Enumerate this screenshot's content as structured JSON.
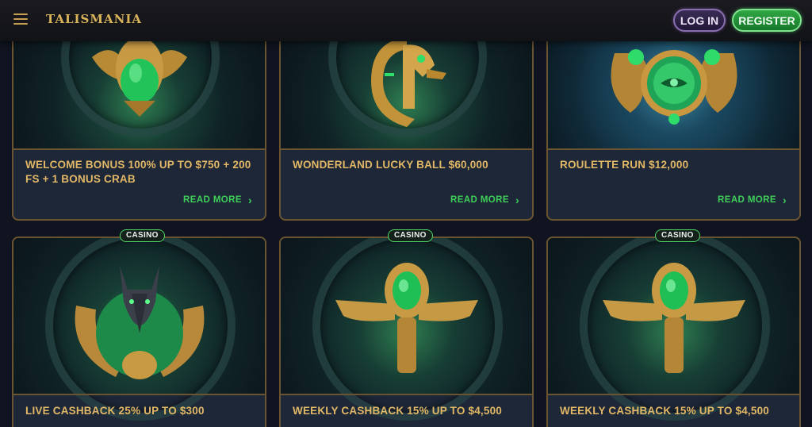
{
  "header": {
    "logo": "TALISMANIA",
    "login_label": "LOG IN",
    "register_label": "REGISTER"
  },
  "cards": [
    {
      "title": "WELCOME BONUS 100% UP TO $750 + 200 FS + 1 BONUS CRAB",
      "cta": "READ MORE"
    },
    {
      "title": "WONDERLAND LUCKY BALL $60,000",
      "cta": "READ MORE"
    },
    {
      "title": "ROULETTE RUN $12,000",
      "cta": "READ MORE"
    },
    {
      "title": "LIVE CASHBACK 25% UP TO $300",
      "badge": "CASINO"
    },
    {
      "title": "WEEKLY CASHBACK 15% UP TO $4,500",
      "badge": "CASINO"
    },
    {
      "title": "WEEKLY CASHBACK 15% UP TO $4,500",
      "badge": "CASINO"
    }
  ],
  "icons": {
    "menu": "hamburger-icon",
    "chevron": "chevron-right-icon"
  },
  "colors": {
    "accent_gold": "#e2b866",
    "read_more_green": "#3fcf59",
    "register_green": "#2fa744",
    "login_purple": "#3a2c55",
    "card_bg": "#1d2738",
    "card_border": "#6b5530"
  }
}
